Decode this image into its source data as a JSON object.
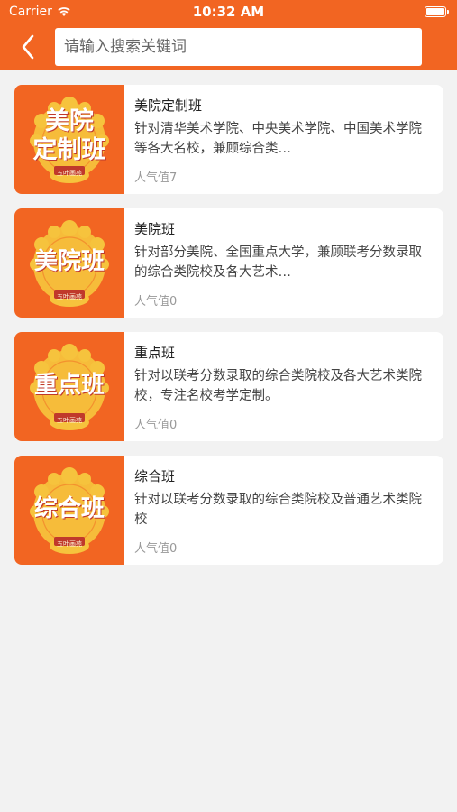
{
  "status_bar": {
    "carrier": "Carrier",
    "time": "10:32 AM"
  },
  "header": {
    "search_placeholder": "请输入搜索关键词"
  },
  "colors": {
    "brand": "#f26522",
    "gold": "#f6c33d",
    "background": "#f2f2f2"
  },
  "courses": [
    {
      "thumb_title": "美院定制班",
      "thumb_lines": [
        "美院",
        "定制班"
      ],
      "thumb_sub": "五叶画苑",
      "title": "美院定制班",
      "description": "针对清华美术学院、中央美术学院、中国美术学院等各大名校，兼顾综合类…",
      "popularity": "人气值7"
    },
    {
      "thumb_title": "美院班",
      "thumb_lines": [
        "美院班"
      ],
      "thumb_sub": "五叶画苑",
      "title": "美院班",
      "description": "针对部分美院、全国重点大学，兼顾联考分数录取的综合类院校及各大艺术…",
      "popularity": "人气值0"
    },
    {
      "thumb_title": "重点班",
      "thumb_lines": [
        "重点班"
      ],
      "thumb_sub": "五叶画苑",
      "title": "重点班",
      "description": "针对以联考分数录取的综合类院校及各大艺术类院校，专注名校考学定制。",
      "popularity": "人气值0"
    },
    {
      "thumb_title": "综合班",
      "thumb_lines": [
        "综合班"
      ],
      "thumb_sub": "五叶画苑",
      "title": "综合班",
      "description": "针对以联考分数录取的综合类院校及普通艺术类院校",
      "popularity": "人气值0"
    }
  ]
}
